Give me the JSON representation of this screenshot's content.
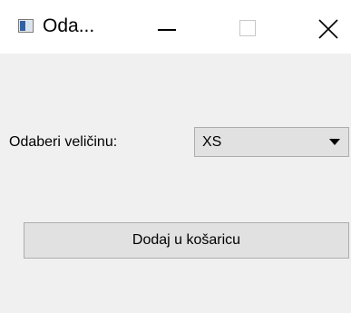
{
  "window": {
    "title": "Oda..."
  },
  "form": {
    "size_label": "Odaberi veličinu:",
    "size_select": {
      "selected": "XS"
    },
    "add_button_label": "Dodaj u košaricu"
  }
}
